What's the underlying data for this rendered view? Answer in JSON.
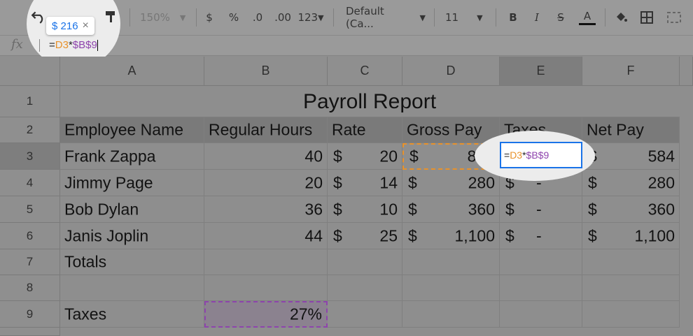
{
  "toolbar": {
    "undo_icon": "undo-icon",
    "zoom": "150%",
    "currency": "$",
    "percent": "%",
    "decrease_decimal": ".0",
    "increase_decimal": ".00",
    "more_formats": "123",
    "font": "Default (Ca...",
    "font_size": "11",
    "bold": "B",
    "italic": "I",
    "strike": "S",
    "text_color": "A"
  },
  "formula_bar": {
    "fx": "fx",
    "eq": "=",
    "ref1": "D3",
    "op": "*",
    "ref2": "$B$9"
  },
  "preview_chip": {
    "value": "$ 216",
    "close": "×"
  },
  "columns": [
    "A",
    "B",
    "C",
    "D",
    "E",
    "F"
  ],
  "rows": [
    "1",
    "2",
    "3",
    "4",
    "5",
    "6",
    "7",
    "8",
    "9"
  ],
  "sheet": {
    "title": "Payroll Report",
    "headers": [
      "Employee Name",
      "Regular Hours",
      "Rate",
      "Gross Pay",
      "Taxes",
      "Net Pay"
    ],
    "employees": [
      {
        "name": "Frank Zappa",
        "hours": "40",
        "rate": "20",
        "gross": "800",
        "taxes": "",
        "net": "584"
      },
      {
        "name": "Jimmy Page",
        "hours": "20",
        "rate": "14",
        "gross": "280",
        "taxes": "-",
        "net": "280"
      },
      {
        "name": "Bob Dylan",
        "hours": "36",
        "rate": "10",
        "gross": "360",
        "taxes": "-",
        "net": "360"
      },
      {
        "name": "Janis Joplin",
        "hours": "44",
        "rate": "25",
        "gross": "1,100",
        "taxes": "-",
        "net": "1,100"
      }
    ],
    "currency_symbol": "$",
    "totals_label": "Totals",
    "taxes_label": "Taxes",
    "tax_rate": "27%"
  },
  "colors": {
    "ref_orange": "#e8922b",
    "ref_purple": "#8e44ad",
    "selection_blue": "#1a73e8"
  }
}
